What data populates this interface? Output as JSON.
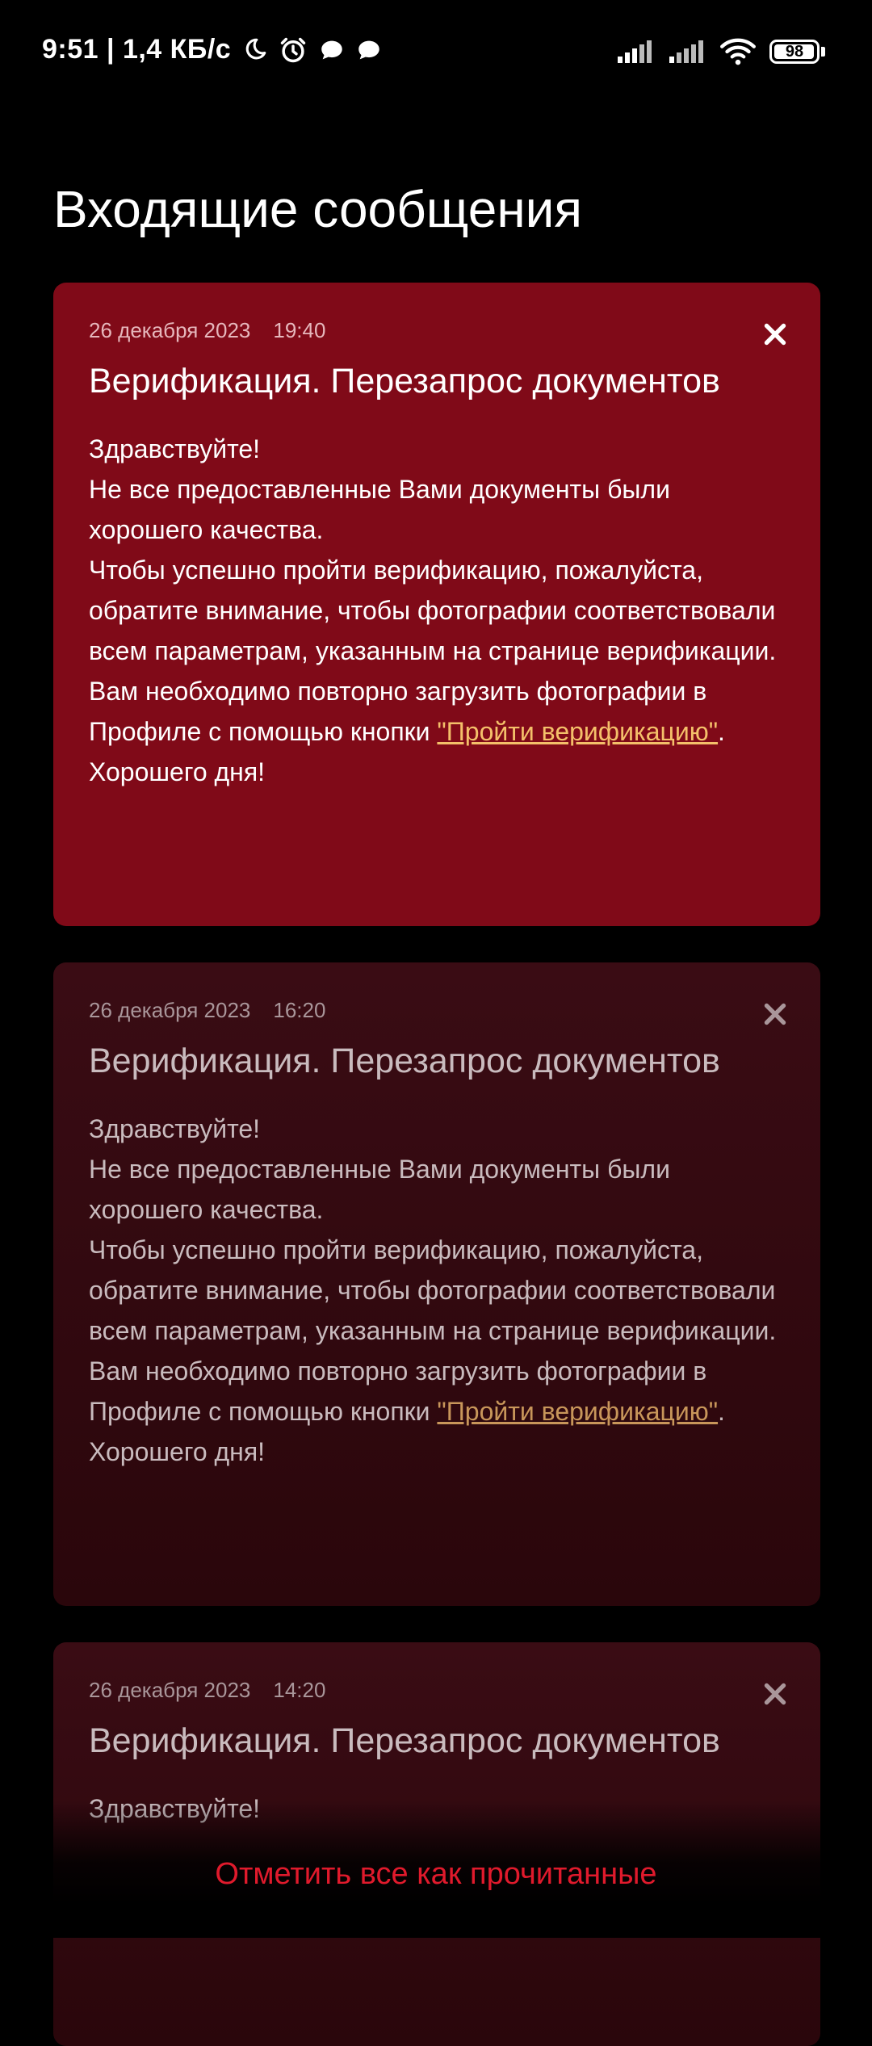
{
  "status_bar": {
    "time_speed": "9:51 | 1,4 КБ/с",
    "icons": [
      "moon-icon",
      "alarm-icon",
      "chat-bubble-icon",
      "chat-bubble-icon",
      "signal-icon",
      "signal-icon",
      "wifi-icon",
      "battery-icon"
    ],
    "battery_level": "98"
  },
  "page": {
    "title": "Входящие сообщения"
  },
  "messages": [
    {
      "date": "26 декабря 2023",
      "time": "19:40",
      "title": "Верификация. Перезапрос документов",
      "body": {
        "greeting": "Здравствуйте!",
        "line1": "Не все предоставленные Вами документы были хорошего качества.",
        "line2": "Чтобы успешно пройти верификацию, пожалуйста, обратите внимание, чтобы фотографии соответствовали всем параметрам, указанным на странице верификации.",
        "line3_before": "Вам необходимо повторно загрузить фотографии в Профиле с помощью кнопки ",
        "link": "\"Пройти верификацию\"",
        "line3_after": ".",
        "closing": "Хорошего дня!"
      },
      "unread": true
    },
    {
      "date": "26 декабря 2023",
      "time": "16:20",
      "title": "Верификация. Перезапрос документов",
      "body": {
        "greeting": "Здравствуйте!",
        "line1": "Не все предоставленные Вами документы были хорошего качества.",
        "line2": "Чтобы успешно пройти верификацию, пожалуйста, обратите внимание, чтобы фотографии соответствовали всем параметрам, указанным на странице верификации.",
        "line3_before": "Вам необходимо повторно загрузить фотографии в Профиле с помощью кнопки ",
        "link": "\"Пройти верификацию\"",
        "line3_after": ".",
        "closing": "Хорошего дня!"
      },
      "unread": false
    },
    {
      "date": "26 декабря 2023",
      "time": "14:20",
      "title": "Верификация. Перезапрос документов",
      "body": {
        "greeting": "Здравствуйте!"
      },
      "unread": false
    }
  ],
  "footer": {
    "mark_all_label": "Отметить все как прочитанные"
  },
  "colors": {
    "background": "#000000",
    "unread_card": "#800a18",
    "read_card": "#2f080e",
    "link_unread": "#f4c06a",
    "accent": "#e01a2c"
  }
}
